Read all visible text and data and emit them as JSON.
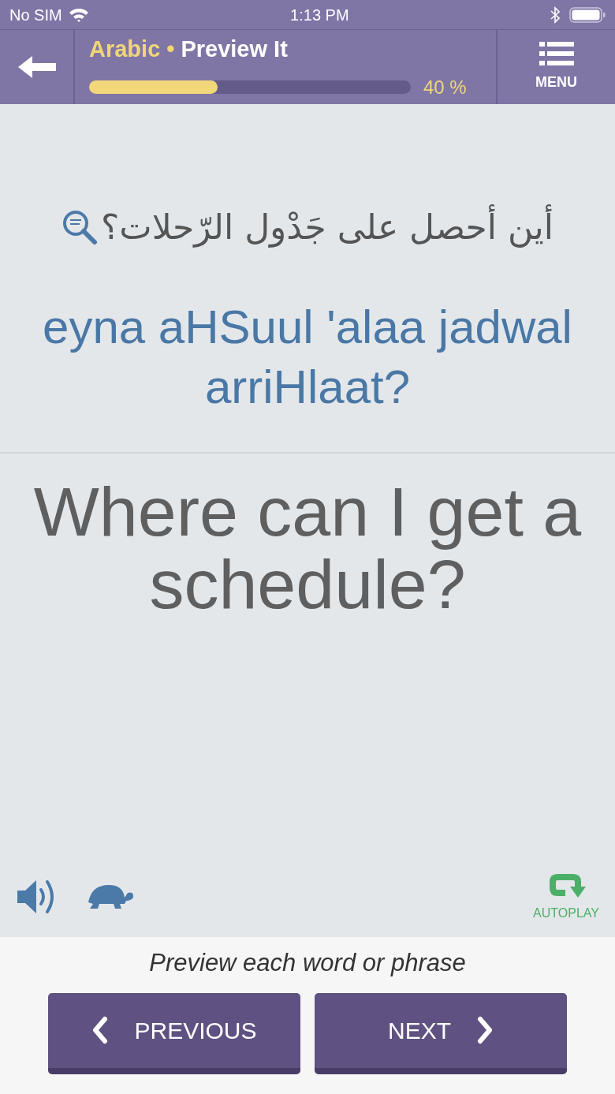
{
  "status_bar": {
    "carrier": "No SIM",
    "time": "1:13 PM"
  },
  "header": {
    "language": "Arabic",
    "separator": "•",
    "mode": "Preview It",
    "progress": {
      "level": 0.4,
      "reading": "40 %"
    },
    "menu_label": "MENU"
  },
  "card": {
    "arabic": "أين أحصل على جَدْول الرّحلات؟",
    "transliteration": "eyna aHSuul 'alaa jadwal arriHlaat?",
    "english": "Where can I get a schedule?"
  },
  "controls": {
    "autoplay_label": "AUTOPLAY"
  },
  "footer": {
    "instruction": "Preview each word or phrase",
    "buttons": [
      {
        "kind": "previous",
        "label": "PREVIOUS"
      },
      {
        "kind": "next",
        "label": "NEXT"
      }
    ]
  }
}
